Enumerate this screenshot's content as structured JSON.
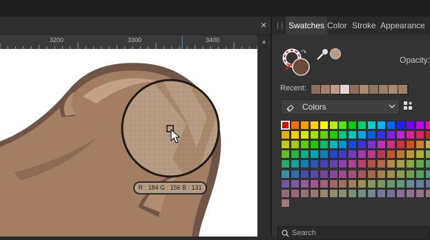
{
  "document": {
    "close_glyph": "×",
    "ruler_labels": [
      "3200",
      "3300",
      "3400"
    ],
    "loupe_readout": "R : 184 G : 156 B : 131"
  },
  "panel": {
    "tabs": [
      "Swatches",
      "Color",
      "Stroke",
      "Appearance"
    ],
    "active_tab": "Swatches",
    "opacity_label": "Opacity:",
    "recent_label": "Recent:",
    "recent_colors": [
      "#8c6e5a",
      "#a0806a",
      "#bd9b85",
      "#e3d6cf",
      "#8c6e5a",
      "#a98a6c",
      "#8e7560",
      "#9c7d66",
      "#ab8a72",
      "#a18166"
    ],
    "palette_dropdown": {
      "label": "Colors",
      "icon": "palette-icon"
    },
    "grid_options_icon": "grid-add-icon",
    "fill_color": "#6b4a38",
    "picked_color": "#b89c83",
    "swatches": [
      [
        "#e50000",
        "#ff6a00",
        "#ff9c00",
        "#ffd200",
        "#fdfd00",
        "#b8f000",
        "#54e600",
        "#00d200",
        "#00d36a",
        "#00d2c8",
        "#00b4ff",
        "#0064ff",
        "#1d1dff",
        "#7b00ff",
        "#c000ff",
        "#ff00c8"
      ],
      [
        "#e8b000",
        "#f0d000",
        "#d8e800",
        "#a4e000",
        "#5cd800",
        "#1cd000",
        "#00c87c",
        "#00c8c0",
        "#00a8e8",
        "#0060e8",
        "#3030e8",
        "#8020e8",
        "#c020d8",
        "#e020a0",
        "#e02060",
        "#e0201c"
      ],
      [
        "#c8c800",
        "#a0d000",
        "#58d000",
        "#20c800",
        "#00c070",
        "#00b8b8",
        "#0090d8",
        "#1848d8",
        "#4030d8",
        "#8030d0",
        "#c030c0",
        "#d03080",
        "#d03040",
        "#d05020",
        "#d08020",
        "#c8b020"
      ],
      [
        "#60c020",
        "#20b840",
        "#00b088",
        "#00a8b0",
        "#0880c8",
        "#2048c8",
        "#4838c8",
        "#7838c0",
        "#a838b0",
        "#c03888",
        "#c03850",
        "#c05830",
        "#c07830",
        "#c09830",
        "#b0b030",
        "#80b830"
      ],
      [
        "#28a860",
        "#18a0a0",
        "#1080b8",
        "#2858b8",
        "#4840b8",
        "#6840b0",
        "#9040a8",
        "#b04090",
        "#b84068",
        "#b85040",
        "#b86840",
        "#b88840",
        "#a8a040",
        "#88a840",
        "#60a848",
        "#40a868"
      ],
      [
        "#3890a8",
        "#3070a8",
        "#4050a8",
        "#5848a8",
        "#7048a0",
        "#8848a0",
        "#a04890",
        "#a85078",
        "#a85858",
        "#a86848",
        "#a88048",
        "#a09048",
        "#88a048",
        "#70a050",
        "#58a060",
        "#48a080"
      ],
      [
        "#7058a0",
        "#8058a0",
        "#9858a0",
        "#a05890",
        "#a06080",
        "#a06868",
        "#a07060",
        "#a08058",
        "#989058",
        "#889858",
        "#789860",
        "#689868",
        "#609878",
        "#609090",
        "#6080a0",
        "#6870a0"
      ],
      [
        "#906880",
        "#986878",
        "#987070",
        "#987868",
        "#988868",
        "#909068",
        "#889070",
        "#789078",
        "#709080",
        "#708890",
        "#707898",
        "#787098",
        "#887098",
        "#907090",
        "#98708a",
        "#987080"
      ],
      [
        "#9e7c7e"
      ]
    ],
    "search_placeholder": "Search"
  }
}
